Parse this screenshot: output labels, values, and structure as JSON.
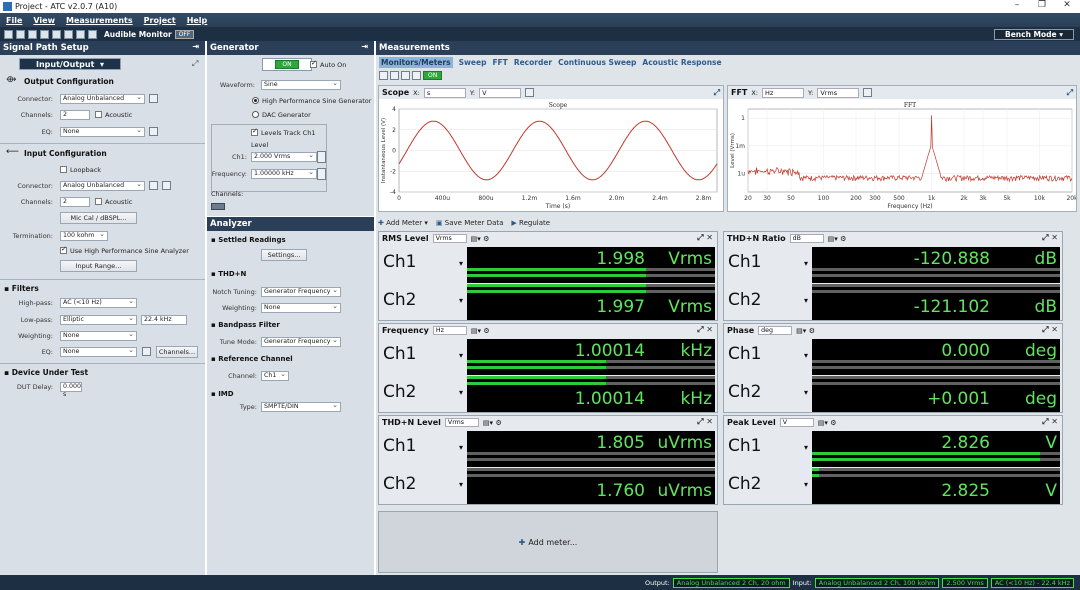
{
  "window": {
    "title": "Project - ATC v2.0.7 (A10)",
    "minimize": "–",
    "restore": "❐",
    "close": "✕"
  },
  "menu": [
    "File",
    "View",
    "Measurements",
    "Project",
    "Help"
  ],
  "toolbar": {
    "audible_monitor": "Audible Monitor",
    "off_label": "OFF",
    "mode": "Bench Mode"
  },
  "signal_path": {
    "title": "Signal Path Setup",
    "selector": "Input/Output",
    "output": {
      "heading": "Output Configuration",
      "connector_label": "Connector:",
      "connector": "Analog Unbalanced",
      "channels_label": "Channels:",
      "channels": "2",
      "acoustic": "Acoustic",
      "eq_label": "EQ:",
      "eq": "None"
    },
    "input": {
      "heading": "Input Configuration",
      "loopback": "Loopback",
      "connector_label": "Connector:",
      "connector": "Analog Unbalanced",
      "channels_label": "Channels:",
      "channels": "2",
      "acoustic": "Acoustic",
      "mic_cal": "Mic Cal / dBSPL...",
      "termination_label": "Termination:",
      "termination": "100 kohm",
      "hp_sine": "Use High Performance Sine Analyzer",
      "input_range": "Input Range..."
    },
    "filters": {
      "heading": "Filters",
      "highpass_label": "High-pass:",
      "highpass": "AC (<10 Hz)",
      "lowpass_label": "Low-pass:",
      "lowpass": "Elliptic",
      "lowpass_freq": "22.4 kHz",
      "weighting_label": "Weighting:",
      "weighting": "None",
      "eq_label": "EQ:",
      "eq": "None",
      "channels_btn": "Channels..."
    },
    "dut": {
      "heading": "Device Under Test",
      "delay_label": "DUT Delay:",
      "delay": "0.000 s"
    }
  },
  "generator": {
    "title": "Generator",
    "on_label": "ON",
    "auto_on": "Auto On",
    "waveform_label": "Waveform:",
    "waveform": "Sine",
    "opt1": "High Performance Sine Generator",
    "opt2": "DAC Generator",
    "levels_track": "Levels Track Ch1",
    "level_label": "Level",
    "ch1_label": "Ch1:",
    "ch1": "2.000 Vrms",
    "freq_label": "Frequency:",
    "freq": "1.00000 kHz",
    "channels_label": "Channels:"
  },
  "analyzer": {
    "title": "Analyzer",
    "settled": "Settled Readings",
    "settings_btn": "Settings...",
    "thdn": "THD+N",
    "notch_label": "Notch Tuning:",
    "notch": "Generator Frequency",
    "weight_label": "Weighting:",
    "weight": "None",
    "bandpass": "Bandpass Filter",
    "tune_label": "Tune Mode:",
    "tune": "Generator Frequency",
    "reference": "Reference Channel",
    "ref_ch_label": "Channel:",
    "ref_ch": "Ch1",
    "imd": "IMD",
    "type_label": "Type:",
    "type": "SMPTE/DIN"
  },
  "measurements": {
    "title": "Measurements",
    "tabs": [
      "Monitors/Meters",
      "Sweep",
      "FFT",
      "Recorder",
      "Continuous Sweep",
      "Acoustic Response"
    ],
    "on_label": "ON",
    "add_meter": "Add Meter",
    "save_meter": "Save Meter Data",
    "regulate": "Regulate",
    "add_meter_btn": "Add meter..."
  },
  "scope": {
    "name": "Scope",
    "x_label": "X:",
    "x_unit": "s",
    "y_label": "Y:",
    "y_unit": "V",
    "plot_title": "Scope",
    "xlabel": "Time (s)",
    "ylabel": "Instantaneous Level (V)",
    "xticks": [
      "0",
      "400u",
      "800u",
      "1.2m",
      "1.6m",
      "2.0m",
      "2.4m",
      "2.8m"
    ],
    "yticks": [
      "4",
      "2",
      "0",
      "-2",
      "-4"
    ]
  },
  "fft": {
    "name": "FFT",
    "x_label": "X:",
    "x_unit": "Hz",
    "y_label": "Y:",
    "y_unit": "Vrms",
    "plot_title": "FFT",
    "xlabel": "Frequency (Hz)",
    "ylabel": "Level (Vrms)",
    "xticks": [
      "20",
      "30",
      "50",
      "100",
      "200",
      "300",
      "500",
      "1k",
      "2k",
      "3k",
      "5k",
      "10k",
      "20k"
    ],
    "yticks": [
      "1",
      "1m",
      "1u"
    ]
  },
  "chart_data": [
    {
      "type": "line",
      "title": "Scope",
      "xlabel": "Time (s)",
      "ylabel": "Instantaneous Level (V)",
      "xlim": [
        0,
        0.003
      ],
      "ylim": [
        -4,
        4
      ],
      "series": [
        {
          "name": "Ch1",
          "amplitude": 2.826,
          "frequency_hz": 1000
        }
      ]
    },
    {
      "type": "line",
      "title": "FFT",
      "xlabel": "Frequency (Hz)",
      "ylabel": "Level (Vrms)",
      "xlim": [
        20,
        20000
      ],
      "x_scale": "log",
      "y_scale": "log",
      "series": [
        {
          "name": "Ch1",
          "peak_frequency_hz": 1000,
          "peak_level_vrms": 2.0
        }
      ]
    }
  ],
  "meters": {
    "rms": {
      "title": "RMS Level",
      "unit_sel": "Vrms",
      "ch1": "1.998",
      "ch2": "1.997",
      "unit": "Vrms",
      "fill1": 0.72,
      "fill2": 0.72
    },
    "thdn_ratio": {
      "title": "THD+N Ratio",
      "unit_sel": "dB",
      "ch1": "-120.888",
      "ch2": "-121.102",
      "unit": "dB",
      "fill1": 0,
      "fill2": 0
    },
    "frequency": {
      "title": "Frequency",
      "unit_sel": "Hz",
      "ch1": "1.00014",
      "ch2": "1.00014",
      "unit": "kHz",
      "fill1": 0.56,
      "fill2": 0.56
    },
    "phase": {
      "title": "Phase",
      "unit_sel": "deg",
      "ch1": "0.000",
      "ch2": "+0.001",
      "unit": "deg",
      "fill1": 0,
      "fill2": 0
    },
    "thdn_level": {
      "title": "THD+N Level",
      "unit_sel": "Vrms",
      "ch1": "1.805",
      "ch2": "1.760",
      "unit": "uVrms",
      "fill1": 0,
      "fill2": 0
    },
    "peak": {
      "title": "Peak Level",
      "unit_sel": "V",
      "ch1": "2.826",
      "ch2": "2.825",
      "unit": "V",
      "fill1": 0.92,
      "fill2": 0.03
    }
  },
  "channel_labels": {
    "ch1": "Ch1",
    "ch2": "Ch2"
  },
  "status": {
    "output_label": "Output:",
    "output": "Analog Unbalanced 2 Ch, 20 ohm",
    "input_label": "Input:",
    "input": "Analog Unbalanced 2 Ch, 100 kohm",
    "level": "2.500 Vrms",
    "filter": "AC (<10 Hz) - 22.4 kHz"
  },
  "colors": {
    "accent": "#2b4058",
    "display_text": "#62e35d",
    "bar_fill": "#2ecc3b",
    "trace": "#c0392b"
  }
}
